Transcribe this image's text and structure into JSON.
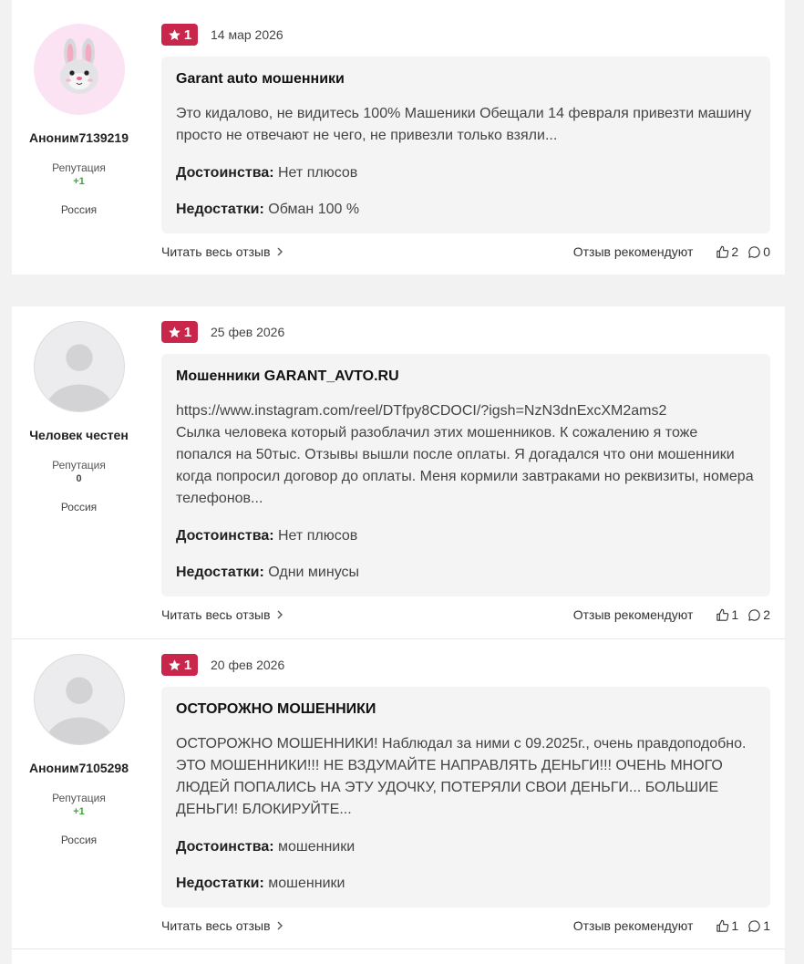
{
  "labels": {
    "reputation": "Репутация",
    "pros": "Достоинства:",
    "cons": "Недостатки:",
    "read_more": "Читать весь отзыв",
    "recommend": "Отзыв рекомендуют"
  },
  "reviews": [
    {
      "author": "Аноним7139219",
      "reputation": "+1",
      "country": "Россия",
      "avatar": "bunny-emoji",
      "rating": "1",
      "date": "14 мар 2026",
      "title": "Garant auto мошенники",
      "excerpt": "Это кидалово, не видитесь 100% Машеники Обещали 14 февраля привезти машину просто не отвечают не чего, не привезли только взяли...",
      "pros": "Нет плюсов",
      "cons": "Обман 100 %",
      "likes": "2",
      "comments": "0"
    },
    {
      "author": "Человек честен",
      "reputation": "0",
      "country": "Россия",
      "avatar": "default-user",
      "rating": "1",
      "date": "25 фев 2026",
      "title": "Мошенники GARANT_AVTO.RU",
      "excerpt_lines": [
        "https://www.instagram.com/reel/DTfpy8CDOCI/?igsh=NzN3dnExcXM2ams2",
        "Сылка человека который разоблачил этих мошенников. К сожалению я тоже попался на 50тыс. Отзывы вышли после оплаты. Я догадался что они мошенники когда попросил договор до оплаты. Меня кормили завтраками но реквизиты, номера телефонов..."
      ],
      "pros": "Нет плюсов",
      "cons": "Одни минусы",
      "likes": "1",
      "comments": "2"
    },
    {
      "author": "Аноним7105298",
      "reputation": "+1",
      "country": "Россия",
      "avatar": "default-user",
      "rating": "1",
      "date": "20 фев 2026",
      "title": "ОСТОРОЖНО МОШЕННИКИ",
      "excerpt": "ОСТОРОЖНО МОШЕННИКИ! Наблюдал за ними с 09.2025г., очень правдоподобно. ЭТО МОШЕННИКИ!!! НЕ ВЗДУМАЙТЕ НАПРАВЛЯТЬ ДЕНЬГИ!!! ОЧЕНЬ МНОГО ЛЮДЕЙ ПОПАЛИСЬ НА ЭТУ УДОЧКУ, ПОТЕРЯЛИ СВОИ ДЕНЬГИ... БОЛЬШИЕ ДЕНЬГИ! БЛОКИРУЙТЕ...",
      "pros": "мошенники",
      "cons": "мошенники",
      "likes": "1",
      "comments": "1"
    }
  ],
  "colors": {
    "badge": "#c8264b",
    "reputation_positive": "#3aa935",
    "box_bg": "#f4f4f5",
    "page_bg": "#f2f2f3"
  }
}
